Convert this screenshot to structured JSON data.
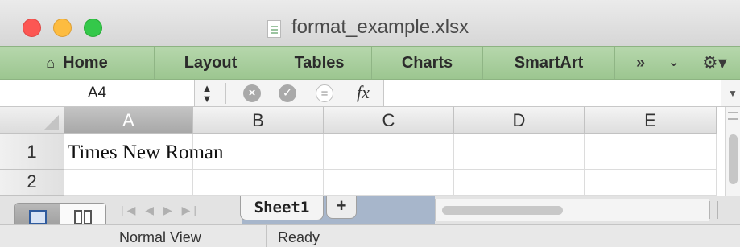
{
  "window": {
    "title": "format_example.xlsx"
  },
  "ribbon": {
    "tabs": [
      {
        "label": "Home",
        "icon": "home-icon"
      },
      {
        "label": "Layout"
      },
      {
        "label": "Tables"
      },
      {
        "label": "Charts"
      },
      {
        "label": "SmartArt"
      }
    ],
    "overflow_label": "»",
    "collapse_icon": "chevron-down-icon",
    "settings_icon": "gear-icon"
  },
  "formula_bar": {
    "name_box": "A4",
    "fx_label": "fx",
    "formula_value": ""
  },
  "grid": {
    "columns": [
      "A",
      "B",
      "C",
      "D",
      "E"
    ],
    "active_column": "A",
    "rows": [
      "1",
      "2"
    ],
    "cells": {
      "A1": "Times New Roman"
    }
  },
  "sheets": {
    "tabs": [
      "Sheet1"
    ],
    "active": "Sheet1",
    "add_label": "+"
  },
  "status": {
    "view_mode": "Normal View",
    "state": "Ready"
  },
  "colors": {
    "ribbon_green": "#a9cf9d",
    "close": "#fc5753",
    "minimize": "#fdbc40",
    "maximize": "#34c84a"
  }
}
